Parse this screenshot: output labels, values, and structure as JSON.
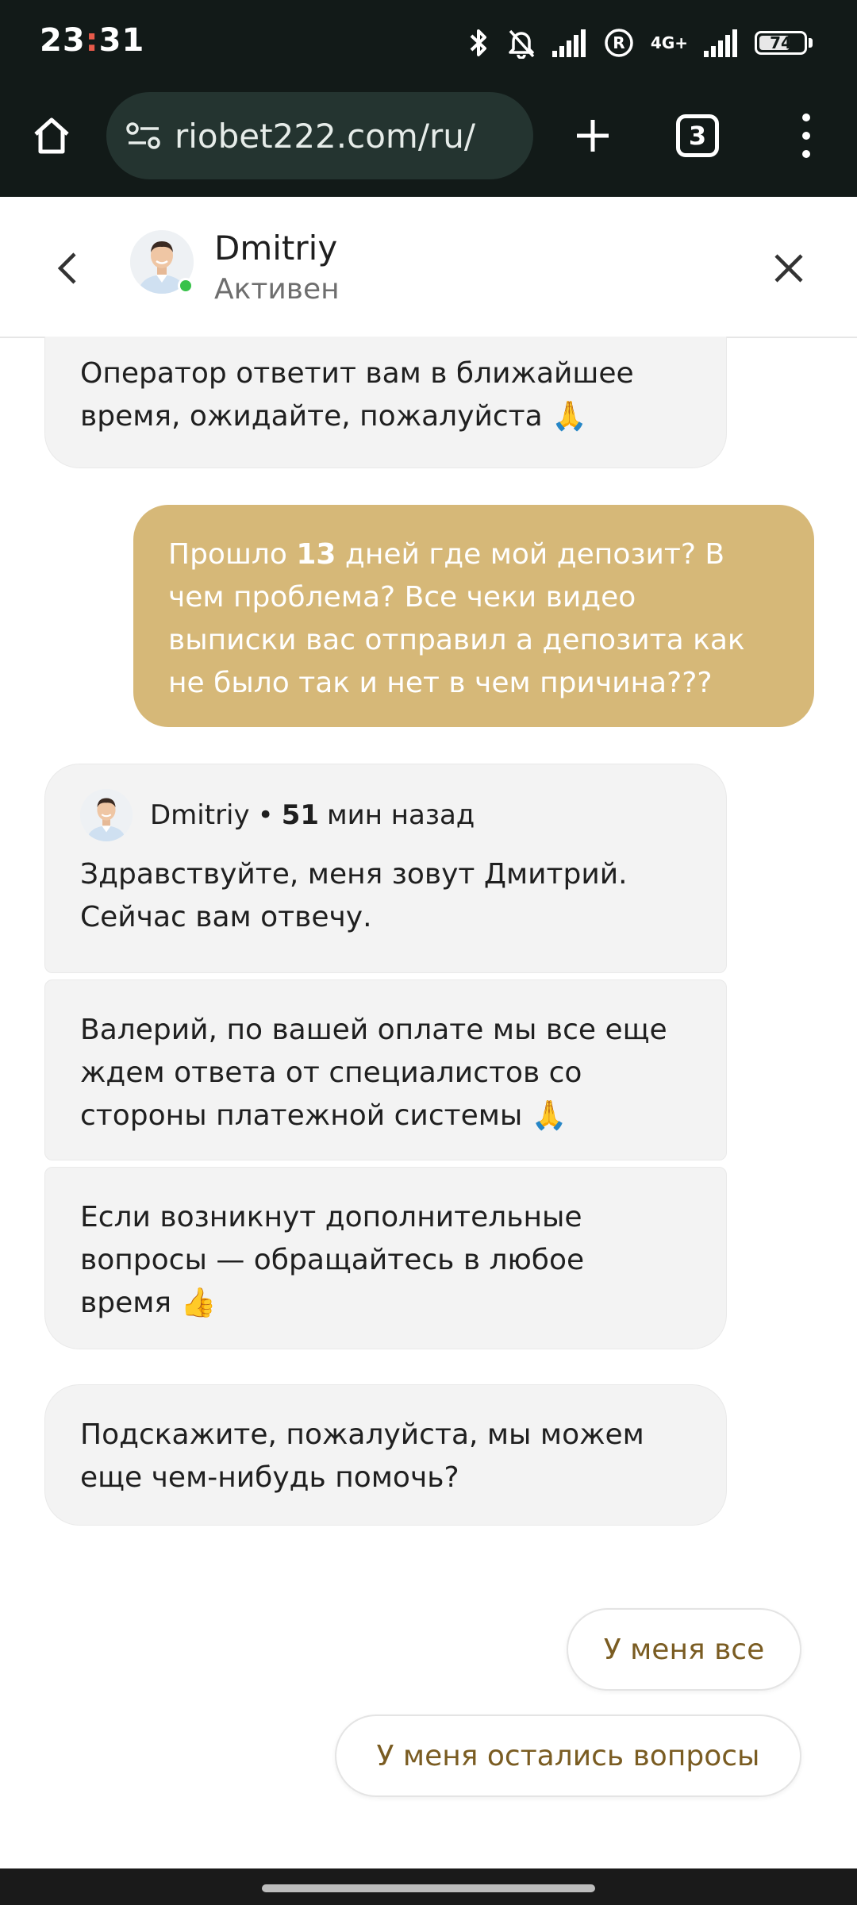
{
  "status_bar": {
    "time_hours": "23",
    "time_colon": ":",
    "time_minutes": "31",
    "network": "4G+",
    "battery": "74",
    "battery_level": 0.74,
    "icons": [
      "bluetooth-icon",
      "mute-icon",
      "signal-icon",
      "roaming-icon",
      "signal-icon",
      "battery-icon"
    ]
  },
  "browser": {
    "url": "riobet222.com/ru/",
    "tab_count": "3",
    "icons": [
      "home-icon",
      "tune-icon",
      "plus-icon",
      "tabs-icon",
      "more-icon"
    ]
  },
  "chat_header": {
    "agent_name": "Dmitriy",
    "agent_status": "Активен",
    "online_color": "#38c24a"
  },
  "messages": {
    "m1_line1": "Оператор ответит вам в ближайшее",
    "m1_line2": "время, ожидайте, пожалуйста 🙏",
    "user_pre": "Прошло ",
    "user_num": "13",
    "user_line1_rest": " дней где мой депозит? В",
    "user_line2": "чем проблема? Все чеки видео",
    "user_line3": "выписки вас отправил а депозита как",
    "user_line4": "не было так и нет в чем причина???",
    "meta_name": "Dmitriy",
    "meta_dot": "•",
    "meta_num": "51",
    "meta_ago": "мин назад",
    "m2_line1": "Здравствуйте, меня зовут Дмитрий.",
    "m2_line2": "Сейчас вам отвечу.",
    "m3_line1": "Валерий, по вашей оплате мы все еще",
    "m3_line2": "ждем ответа от специалистов со",
    "m3_line3": "стороны платежной системы 🙏",
    "m4_line1": "Если возникнут дополнительные",
    "m4_line2": "вопросы — обращайтесь в любое",
    "m4_line3": "время 👍",
    "m5_line1": "Подскажите, пожалуйста, мы можем",
    "m5_line2": "еще чем-нибудь помочь?"
  },
  "quick_replies": {
    "option1": "У меня все",
    "option2": "У меня остались вопросы"
  },
  "colors": {
    "user_bubble": "#d6b878",
    "agent_bubble": "#f3f3f3",
    "quick_reply_text": "#7a5c22"
  }
}
